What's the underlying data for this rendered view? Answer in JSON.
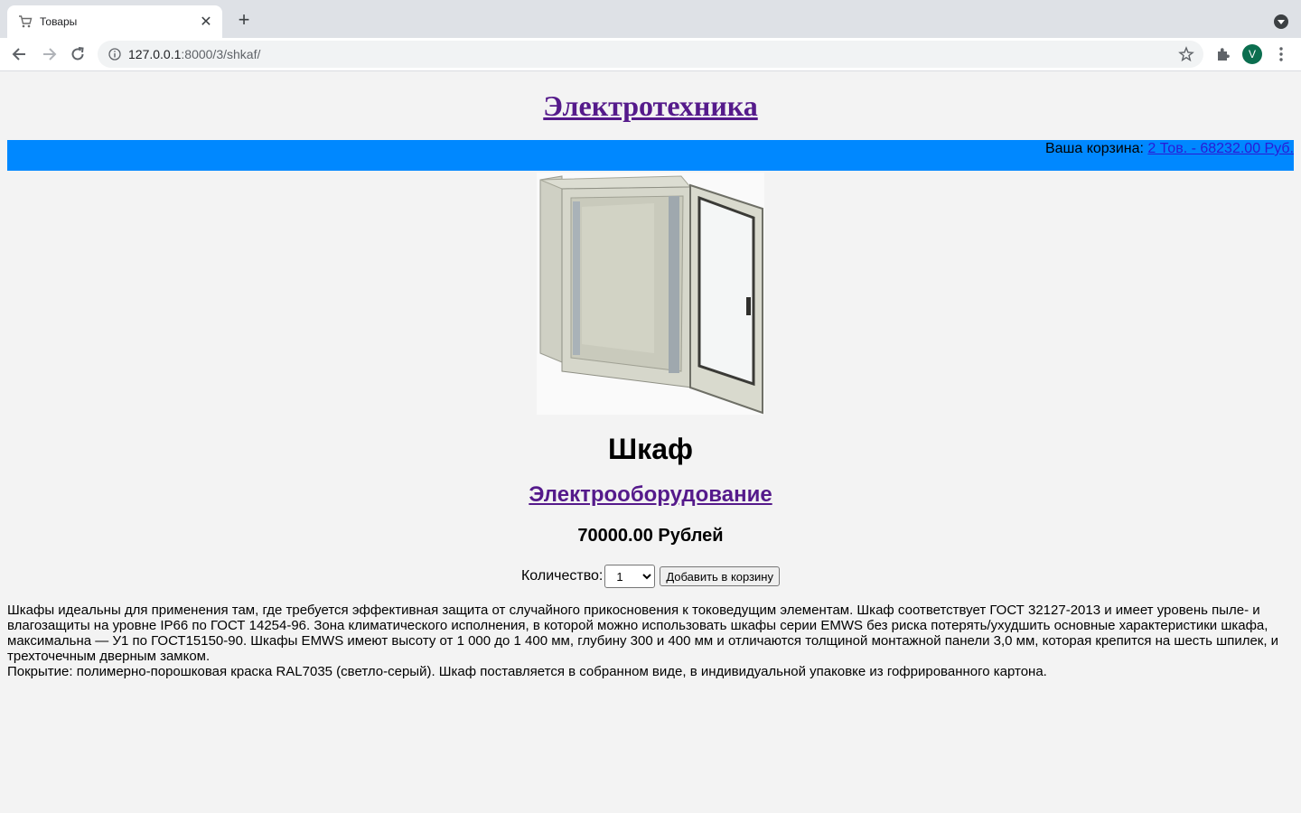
{
  "browser": {
    "tab_title": "Товары",
    "url_host": "127.0.0.1",
    "url_rest": ":8000/3/shkaf/",
    "avatar_letter": "V"
  },
  "site": {
    "title": "Электротехника"
  },
  "cart": {
    "label": "Ваша корзина: ",
    "summary": "2 Тов. - 68232.00 Руб."
  },
  "product": {
    "name": "Шкаф",
    "category": "Электрооборудование",
    "price": "70000.00 Рублей",
    "quantity_label": "Количество:",
    "quantity_value": "1",
    "add_button": "Добавить в корзину",
    "description_1": "Шкафы идеальны для применения там, где требуется эффективная защита от случайного прикосновения к токоведущим элементам. Шкаф соответствует ГОСТ 32127-2013 и имеет уровень пыле- и влагозащиты на уровне IP66 по ГОСТ 14254-96. Зона климатического исполнения, в которой можно использовать шкафы серии EMWS без риска потерять/ухудшить основные характеристики шкафа, максимальна — У1 по ГОСТ15150-90. Шкафы EMWS имеют высоту от 1 000 до 1 400 мм, глубину 300 и 400 мм и отличаются толщиной монтажной панели 3,0 мм, которая крепится на шесть шпилек, и трехточечным дверным замком.",
    "description_2": "Покрытие: полимерно-порошковая краска RAL7035 (светло-серый). Шкаф поставляется в собранном виде, в индивидуальной упаковке из гофрированного картона."
  },
  "colors": {
    "cart_bar": "#0088ff",
    "visited_link": "#551a8b",
    "page_bg": "#f3f3f3"
  }
}
